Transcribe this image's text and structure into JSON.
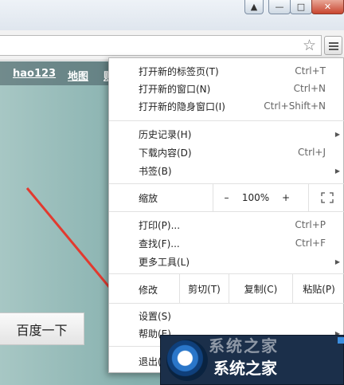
{
  "window": {
    "controls": [
      "user-icon",
      "minimize-icon",
      "maximize-icon",
      "close-icon"
    ]
  },
  "toolbar": {
    "bookmark_icon": "star-icon",
    "menu_icon": "hamburger-menu-icon"
  },
  "page": {
    "nav_links": [
      "hao123",
      "地图",
      "贴"
    ],
    "search_button": "百度一下"
  },
  "menu": {
    "items": [
      {
        "label": "打开新的标签页(T)",
        "shortcut": "Ctrl+T"
      },
      {
        "label": "打开新的窗口(N)",
        "shortcut": "Ctrl+N"
      },
      {
        "label": "打开新的隐身窗口(I)",
        "shortcut": "Ctrl+Shift+N"
      },
      {
        "label": "历史记录(H)",
        "shortcut": ""
      },
      {
        "label": "下载内容(D)",
        "shortcut": "Ctrl+J"
      },
      {
        "label": "书签(B)",
        "shortcut": ""
      },
      {
        "label": "打印(P)...",
        "shortcut": "Ctrl+P"
      },
      {
        "label": "查找(F)...",
        "shortcut": "Ctrl+F"
      },
      {
        "label": "更多工具(L)",
        "shortcut": ""
      },
      {
        "label": "设置(S)",
        "shortcut": ""
      },
      {
        "label": "帮助(E)",
        "shortcut": ""
      },
      {
        "label": "退出(X)",
        "shortcut": ""
      }
    ],
    "zoom": {
      "label": "缩放",
      "minus": "–",
      "value": "100%",
      "plus": "+"
    },
    "edit": {
      "label": "修改",
      "cut": "剪切(T)",
      "copy": "复制(C)",
      "paste": "粘贴(P)"
    }
  },
  "watermark": {
    "text": "系统之家"
  },
  "colors": {
    "page_bg": "#86b0ae",
    "arrow": "#e23a2f",
    "watermark_bg": "#1b2f4a"
  }
}
